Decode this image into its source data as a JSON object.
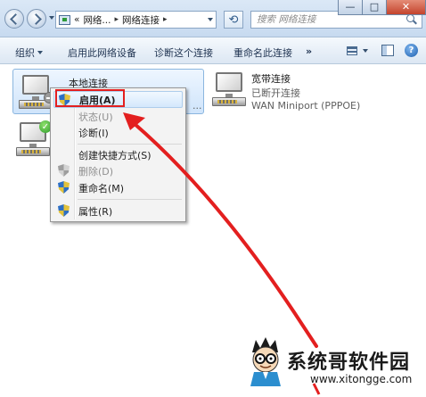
{
  "window": {
    "minimize_glyph": "—",
    "maximize_glyph": "□",
    "close_glyph": "✕"
  },
  "address_bar": {
    "overflow": "«",
    "crumbs": [
      "网络...",
      "网络连接"
    ],
    "separator": "▸",
    "refresh_glyph": "⟲",
    "search_placeholder": "搜索 网络连接"
  },
  "toolbar": {
    "organize": "组织",
    "enable_device": "启用此网络设备",
    "diagnose": "诊断这个连接",
    "rename": "重命名此连接",
    "more": "»",
    "help": "?"
  },
  "connections": {
    "local": {
      "name": "本地连接",
      "tail": "...",
      "icon": "network-adapter-disabled"
    },
    "broadband": {
      "name": "宽带连接",
      "status": "已断开连接",
      "device": "WAN Miniport (PPPOE)",
      "icon": "network-adapter"
    },
    "second": {
      "icon": "network-adapter-connected"
    }
  },
  "context_menu": {
    "items": [
      {
        "label": "启用(A)",
        "state": "highlighted",
        "icon": "shield-icon"
      },
      {
        "label": "状态(U)",
        "state": "disabled"
      },
      {
        "label": "诊断(I)",
        "state": "normal"
      },
      {
        "label": "创建快捷方式(S)",
        "state": "normal"
      },
      {
        "label": "删除(D)",
        "state": "disabled",
        "icon": "shield-icon"
      },
      {
        "label": "重命名(M)",
        "state": "normal",
        "icon": "shield-icon"
      },
      {
        "label": "属性(R)",
        "state": "normal",
        "icon": "shield-icon"
      }
    ]
  },
  "annotation": {
    "highlight_color": "#e31f1f",
    "arrow_color": "#e31f1f"
  },
  "watermark": {
    "title": "系统哥软件园",
    "url": "www.xitongge.com"
  },
  "colors": {
    "chrome": "#dbe8f6",
    "selection": "#cfe4fb",
    "close_button": "#c4442d"
  }
}
